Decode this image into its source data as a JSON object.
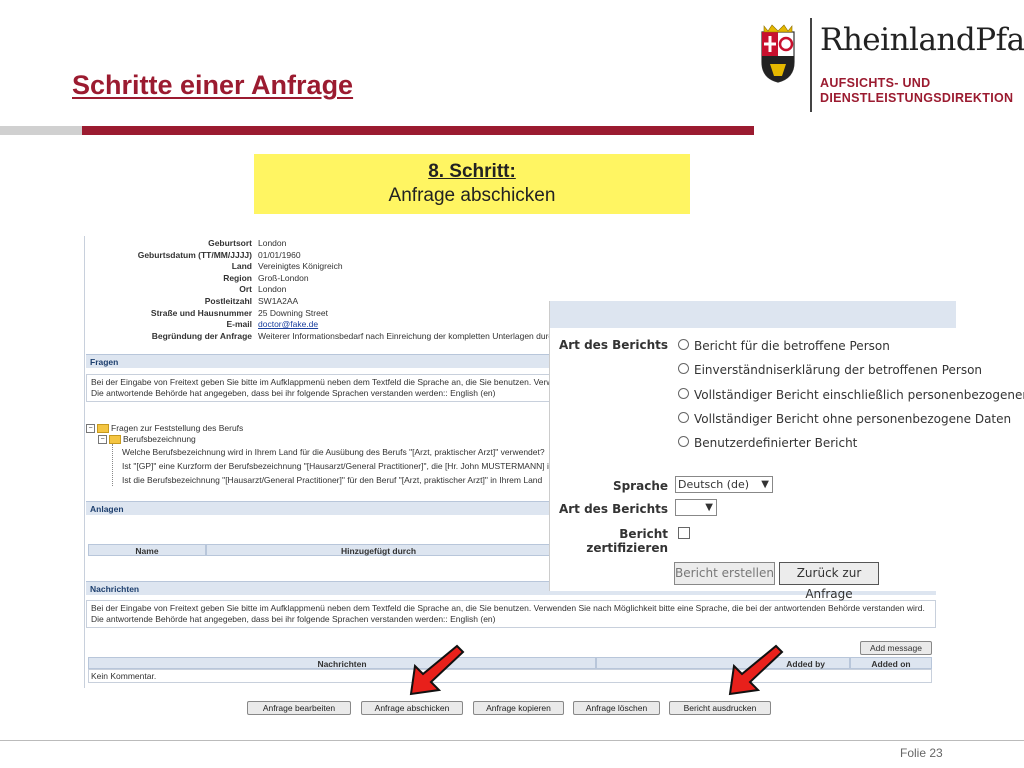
{
  "slide": {
    "title": "Schritte einer Anfrage",
    "step_title": "8. Schritt:",
    "step_subtitle": "Anfrage abschicken",
    "footer": "Folie 23"
  },
  "logo": {
    "name": "RheinlandPfalz",
    "sub_line1": "AUFSICHTS- UND",
    "sub_line2": "DIENSTLEISTUNGSDIREKTION"
  },
  "details": [
    {
      "label": "Geburtsort",
      "value": "London"
    },
    {
      "label": "Geburtsdatum (TT/MM/JJJJ)",
      "value": "01/01/1960"
    },
    {
      "label": "Land",
      "value": "Vereinigtes Königreich"
    },
    {
      "label": "Region",
      "value": "Groß-London"
    },
    {
      "label": "Ort",
      "value": "London"
    },
    {
      "label": "Postleitzahl",
      "value": "SW1A2AA"
    },
    {
      "label": "Straße und Hausnummer",
      "value": "25 Downing Street"
    },
    {
      "label": "E-mail",
      "value": "doctor@fake.de"
    },
    {
      "label": "Begründung der Anfrage",
      "value": "Weiterer Informationsbedarf nach Einreichung der kompletten Unterlagen durch"
    }
  ],
  "fragen": {
    "header": "Fragen",
    "info_line1": "Bei der Eingabe von Freitext geben Sie bitte im Aufklappmenü neben dem Textfeld die Sprache an, die Sie benutzen. Verwen",
    "info_line2": "Die antwortende Behörde hat angegeben, dass bei ihr folgende Sprachen verstanden werden:: English (en)",
    "tree_root": "Fragen zur Feststellung des Berufs",
    "tree_child": "Berufsbezeichnung",
    "tree_q1": "Welche Berufsbezeichnung wird in Ihrem Land für die Ausübung des Berufs \"[Arzt, praktischer Arzt]\" verwendet?",
    "tree_q2": "Ist \"[GP]\" eine Kurzform der Berufsbezeichnung \"[Hausarzt/General Practitioner]\", die [Hr. John MUSTERMANN] in",
    "tree_q3": "Ist die Berufsbezeichnung \"[Hausarzt/General Practitioner]\" für den Beruf \"[Arzt, praktischer Arzt]\" in Ihrem Land"
  },
  "anlagen": {
    "header": "Anlagen",
    "col_name": "Name",
    "col_added": "Hinzugefügt durch"
  },
  "nachrichten": {
    "header": "Nachrichten",
    "info_line1": "Bei der Eingabe von Freitext geben Sie bitte im Aufklappmenü neben dem Textfeld die Sprache an, die Sie benutzen. Verwenden Sie nach Möglichkeit bitte eine Sprache, die bei der antwortenden Behörde verstanden wird.",
    "info_line2": "Die antwortende Behörde hat angegeben, dass bei ihr folgende Sprachen verstanden werden:: English (en)",
    "add_message": "Add message",
    "col_msg": "Nachrichten",
    "col_added_by": "Added by",
    "col_added_on": "Added on",
    "empty": "Kein Kommentar."
  },
  "bottom_buttons": {
    "edit": "Anfrage bearbeiten",
    "send": "Anfrage abschicken",
    "copy": "Anfrage kopieren",
    "delete": "Anfrage löschen",
    "print": "Bericht ausdrucken"
  },
  "dialog": {
    "report_type_label": "Art des Berichts",
    "options": [
      "Bericht für die betroffene Person",
      "Einverständniserklärung der betroffenen Person",
      "Vollständiger Bericht einschließlich personenbezogener Daten",
      "Vollständiger Bericht ohne personenbezogene Daten",
      "Benutzerdefinierter Bericht"
    ],
    "language_label": "Sprache",
    "language_value": "Deutsch (de)",
    "report_type_label2": "Art des Berichts",
    "report_type_value": "",
    "certify_label": "Bericht zertifizieren",
    "create_button": "Bericht erstellen",
    "back_button": "Zurück zur Anfrage"
  },
  "colors": {
    "accent_red": "#9b1b30",
    "step_yellow": "#fff562",
    "arrow_red": "#e8201b"
  }
}
